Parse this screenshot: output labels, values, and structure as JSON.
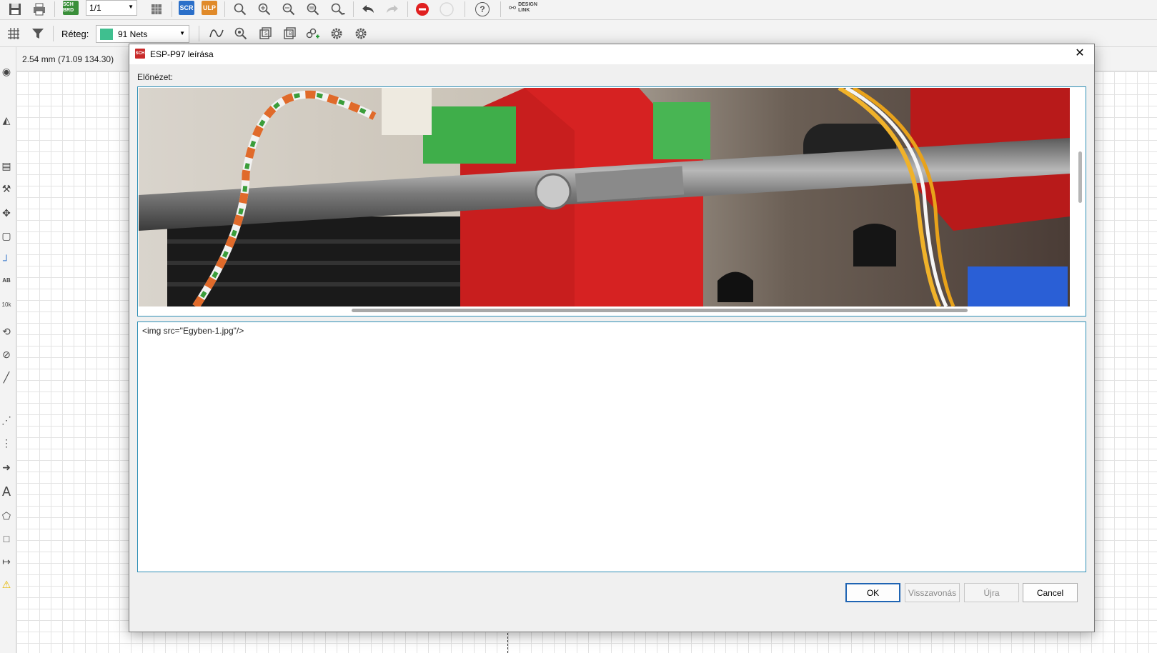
{
  "toolbar_top": {
    "page_select_value": "1/1",
    "sch_brd_badge": "SCH BRD",
    "scr_badge": "SCR",
    "ulp_badge": "ULP",
    "help_glyph": "?",
    "design_link_label": "DESIGN LINK",
    "icons": [
      "save-icon",
      "print-icon",
      "sch-brd-switch-icon",
      "cam-icon",
      "script-icon",
      "ulp-icon",
      "zoom-fit-icon",
      "zoom-in-icon",
      "zoom-out-icon",
      "zoom-select-icon",
      "zoom-area-icon",
      "undo-icon",
      "redo-icon",
      "stop-icon",
      "go-icon",
      "help-icon",
      "design-link-icon"
    ]
  },
  "toolbar_second": {
    "layer_label": "Réteg:",
    "layer_value": "91 Nets",
    "layer_color": "#3fbf8f",
    "icons": [
      "grid-icon",
      "filter-icon",
      "wire-style-icon",
      "inspect-icon",
      "icon-a",
      "icon-b",
      "add-link-icon",
      "settings-icon",
      "settings-2-icon"
    ]
  },
  "coords": {
    "readout": "2.54 mm (71.09 134.30)"
  },
  "left_toolbar": {
    "icons": [
      "eye-icon",
      "mirror-icon",
      "paste-icon",
      "wrench-icon",
      "move-icon",
      "group-icon",
      "net-icon",
      "label-icon",
      "value-icon",
      "rotate-icon",
      "ruler-icon",
      "line-icon",
      "split-icon",
      "route-icon",
      "bus-icon",
      "text-icon",
      "polygon-icon",
      "rect-icon",
      "dimension-icon",
      "warning-icon"
    ],
    "text_glyph": "A",
    "label_glyph": "AB"
  },
  "dialog": {
    "title": "ESP-P97 leírása",
    "app_icon_text": "SCH",
    "close_glyph": "✕",
    "preview_label": "Előnézet:",
    "source_text": "<img src=\"Egyben-1.jpg\"/>",
    "buttons": {
      "ok": "OK",
      "undo": "Visszavonás",
      "redo": "Újra",
      "cancel": "Cancel"
    }
  },
  "colors": {
    "accent_border": "#2e8fb5",
    "ok_border": "#1f64b3",
    "app_red": "#c92a2a"
  }
}
